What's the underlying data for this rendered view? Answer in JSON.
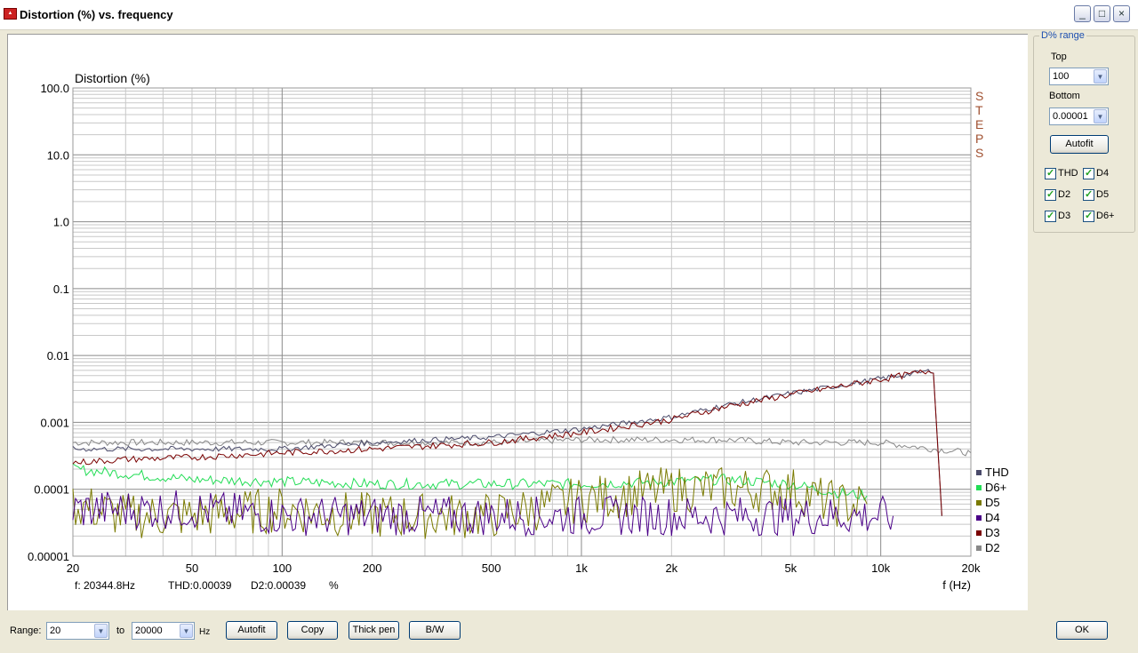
{
  "window": {
    "title": "Distortion (%) vs. frequency",
    "icon": "steps-app-icon"
  },
  "chart_data": {
    "type": "line",
    "title": "Distortion (%)",
    "xlabel": "f (Hz)",
    "ylabel": "Distortion (%)",
    "x_scale": "log",
    "y_scale": "log",
    "xlim": [
      20,
      20000
    ],
    "ylim": [
      1e-05,
      100
    ],
    "x_ticks": [
      "20",
      "50",
      "100",
      "200",
      "500",
      "1k",
      "2k",
      "5k",
      "10k",
      "20k"
    ],
    "y_ticks": [
      "100.0",
      "10.0",
      "1.0",
      "0.1",
      "0.01",
      "0.001",
      "0.0001",
      "0.00001"
    ],
    "watermark": "STEPS",
    "grid": true,
    "legend_placement": "right",
    "series": [
      {
        "name": "THD",
        "color": "#4a4a6a",
        "x": [
          20,
          30,
          50,
          100,
          200,
          500,
          1000,
          2000,
          3000,
          5000,
          8000,
          10000,
          15000,
          16000
        ],
        "y": [
          0.0004,
          0.0004,
          0.0004,
          0.0004,
          0.0005,
          0.0006,
          0.0008,
          0.0012,
          0.0018,
          0.0027,
          0.0038,
          0.0045,
          0.006,
          4e-05
        ]
      },
      {
        "name": "D6+",
        "color": "#22dd55",
        "x": [
          20,
          50,
          100,
          200,
          500,
          1000,
          2000,
          3000,
          5000,
          7000,
          9000
        ],
        "y": [
          0.0002,
          0.00014,
          0.00013,
          0.00012,
          0.00012,
          0.00012,
          0.00013,
          0.00014,
          0.00012,
          9e-05,
          8e-05
        ]
      },
      {
        "name": "D5",
        "color": "#7a7a00",
        "x": [
          20,
          30,
          50,
          100,
          200,
          500,
          1000,
          2000,
          3000,
          5000,
          7000,
          9000
        ],
        "y": [
          6e-05,
          4e-05,
          4e-05,
          5e-05,
          4e-05,
          4e-05,
          7e-05,
          0.0001,
          0.0001,
          0.0001,
          6e-05,
          6e-05
        ]
      },
      {
        "name": "D4",
        "color": "#4a0088",
        "x": [
          20,
          50,
          100,
          200,
          500,
          1000,
          2000,
          3000,
          5000,
          8000,
          11000
        ],
        "y": [
          5e-05,
          5e-05,
          4e-05,
          4e-05,
          4e-05,
          4e-05,
          4e-05,
          4e-05,
          4e-05,
          4e-05,
          4e-05
        ]
      },
      {
        "name": "D3",
        "color": "#7a0000",
        "x": [
          20,
          30,
          50,
          100,
          200,
          500,
          1000,
          2000,
          3000,
          5000,
          8000,
          10000,
          15000,
          16000
        ],
        "y": [
          0.00025,
          0.00028,
          0.0003,
          0.00035,
          0.0004,
          0.0005,
          0.0007,
          0.0011,
          0.0017,
          0.0026,
          0.0037,
          0.0044,
          0.006,
          4e-05
        ]
      },
      {
        "name": "D2",
        "color": "#888888",
        "x": [
          20,
          50,
          100,
          200,
          500,
          1000,
          2000,
          3000,
          5000,
          10000,
          15000,
          20000
        ],
        "y": [
          0.0005,
          0.0005,
          0.0005,
          0.0005,
          0.0005,
          0.00055,
          0.00055,
          0.00055,
          0.0005,
          0.0005,
          0.0004,
          0.00035
        ]
      }
    ],
    "status": {
      "freq": "f: 20344.8Hz",
      "thd": "THD:0.00039",
      "d2": "D2:0.00039",
      "unit": "%"
    }
  },
  "side_panel": {
    "group_label": "D% range",
    "top_label": "Top",
    "top_value": "100",
    "bottom_label": "Bottom",
    "bottom_value": "0.00001",
    "autofit_label": "Autofit",
    "checkboxes": [
      {
        "label": "THD",
        "checked": true
      },
      {
        "label": "D4",
        "checked": true
      },
      {
        "label": "D2",
        "checked": true
      },
      {
        "label": "D5",
        "checked": true
      },
      {
        "label": "D3",
        "checked": true
      },
      {
        "label": "D6+",
        "checked": true
      }
    ]
  },
  "bottom_bar": {
    "range_label": "Range:",
    "range_from": "20",
    "to_label": "to",
    "range_to": "20000",
    "unit_label": "Hz",
    "autofit_label": "Autofit",
    "copy_label": "Copy",
    "thick_pen_label": "Thick pen",
    "bw_label": "B/W",
    "ok_label": "OK"
  }
}
